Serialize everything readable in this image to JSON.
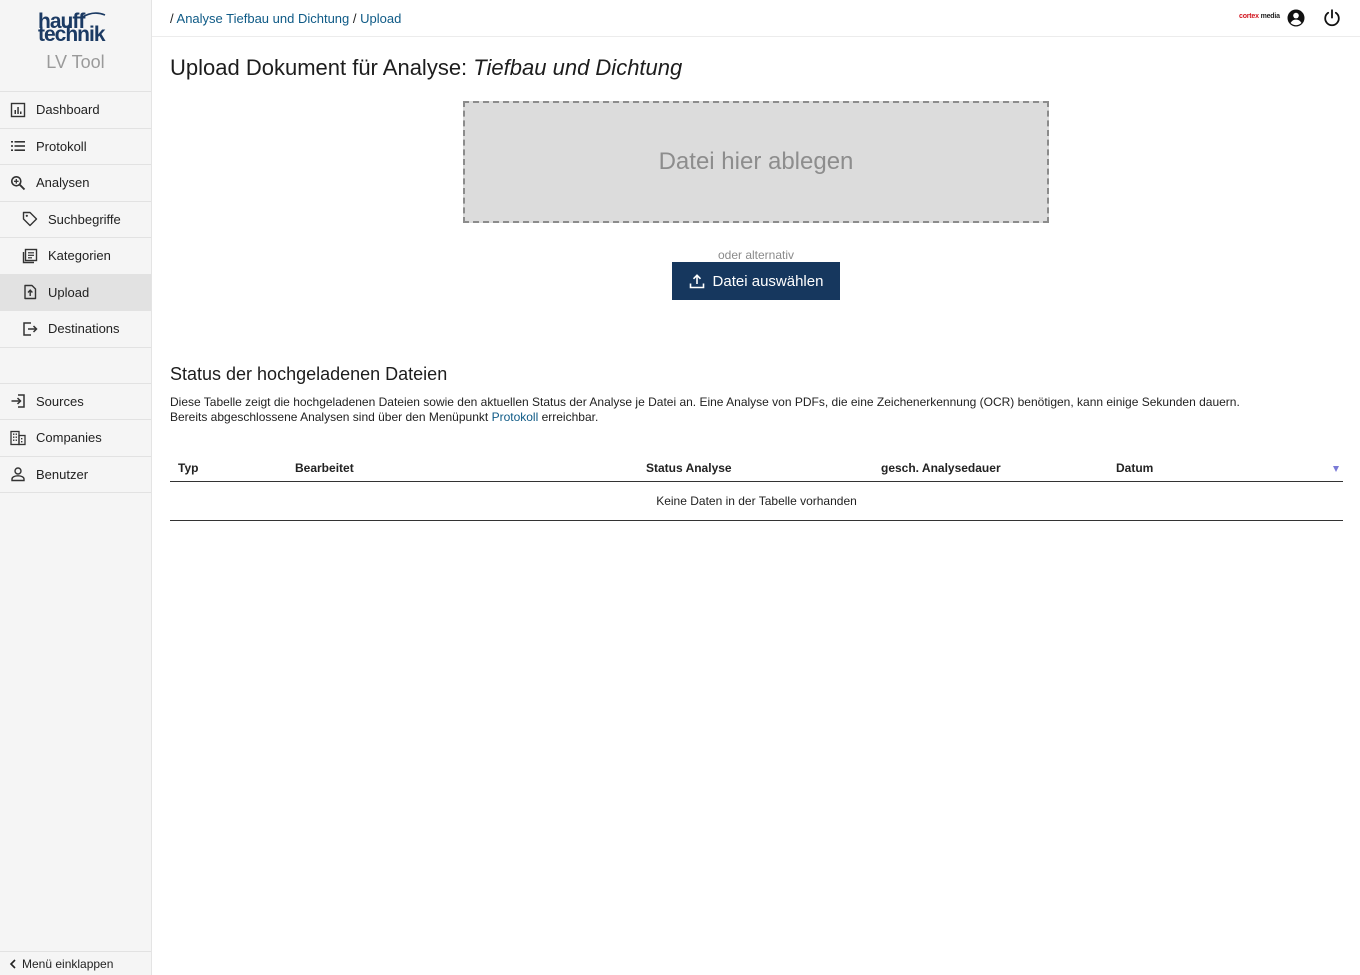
{
  "logo": {
    "line1": "hauff",
    "line2": "technik",
    "subtitle": "LV Tool"
  },
  "sidebar": {
    "items": [
      {
        "label": "Dashboard",
        "icon": "chart-icon"
      },
      {
        "label": "Protokoll",
        "icon": "list-icon"
      },
      {
        "label": "Analysen",
        "icon": "search-icon"
      },
      {
        "label": "Suchbegriffe",
        "icon": "tag-icon"
      },
      {
        "label": "Kategorien",
        "icon": "document-list-icon"
      },
      {
        "label": "Upload",
        "icon": "upload-file-icon",
        "active": true
      },
      {
        "label": "Destinations",
        "icon": "logout-icon"
      },
      {
        "label": "Sources",
        "icon": "login-icon"
      },
      {
        "label": "Companies",
        "icon": "building-icon"
      },
      {
        "label": "Benutzer",
        "icon": "user-icon"
      }
    ],
    "collapse_label": "Menü einklappen"
  },
  "topbar": {
    "breadcrumb": {
      "sep": "/",
      "crumb1": "Analyse Tiefbau und Dichtung",
      "crumb2": "Upload"
    },
    "partner_logo": {
      "part1": "cortex",
      "part2": "media"
    }
  },
  "main": {
    "title_prefix": "Upload Dokument für Analyse:",
    "title_analysis": "Tiefbau und Dichtung",
    "dropzone_label": "Datei hier ablegen",
    "alt_label": "oder alternativ",
    "upload_button": "Datei auswählen",
    "status_title": "Status der hochgeladenen Dateien",
    "status_desc_line1": "Diese Tabelle zeigt die hochgeladenen Dateien sowie den aktuellen Status der Analyse je Datei an. Eine Analyse von PDFs, die eine Zeichenerkennung (OCR) benötigen, kann einige Sekunden dauern.",
    "status_desc_line2_pre": "Bereits abgeschlossene Analysen sind über den Menüpunkt",
    "status_desc_link": "Protokoll",
    "status_desc_line2_post": "erreichbar."
  },
  "table": {
    "columns": [
      "Typ",
      "Bearbeitet",
      "Status Analyse",
      "gesch. Analysedauer",
      "Datum"
    ],
    "empty_text": "Keine Daten in der Tabelle vorhanden",
    "rows": []
  },
  "colors": {
    "primary": "#16375e",
    "link": "#0e5a86",
    "sidebar_bg": "#f5f5f5",
    "active_bg": "#e2e2e2"
  }
}
